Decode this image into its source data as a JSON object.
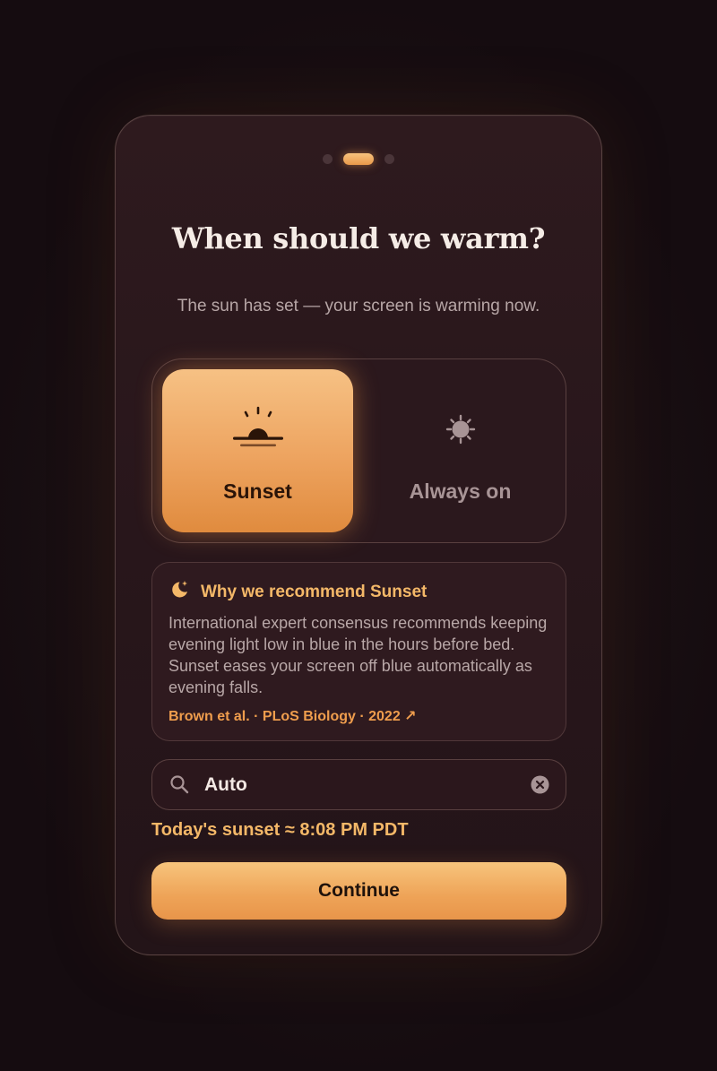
{
  "colors": {
    "accent": "#f4b868",
    "accent_deep": "#e8954a",
    "card_bg": "#2b171c",
    "text_muted": "#b7a6a6"
  },
  "pager": {
    "count": 3,
    "active_index": 1
  },
  "header": {
    "title": "When should we warm?",
    "subtitle": "The sun has set — your screen is warming now."
  },
  "mode_selector": {
    "selected": "sunset",
    "options": [
      {
        "id": "sunset",
        "label": "Sunset",
        "icon": "sunset-icon"
      },
      {
        "id": "always",
        "label": "Always on",
        "icon": "sun-icon"
      }
    ]
  },
  "recommendation": {
    "icon": "moon-stars-icon",
    "title": "Why we recommend Sunset",
    "body": "International expert consensus recommends keeping evening light low in blue in the hours before bed. Sunset eases your screen off blue automatically as evening falls.",
    "citation": "Brown et al. · PLoS Biology · 2022 ↗"
  },
  "location": {
    "value": "Auto",
    "search_icon": "search-icon",
    "clear_icon": "clear-icon"
  },
  "sunset_info": "Today's sunset ≈ 8:08 PM PDT",
  "continue_label": "Continue"
}
